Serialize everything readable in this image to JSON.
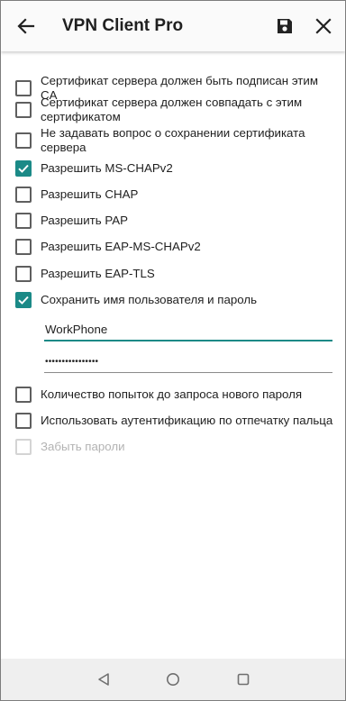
{
  "header": {
    "title": "VPN Client Pro"
  },
  "options": [
    {
      "label": "Сертификат сервера должен быть подписан этим CA",
      "checked": false,
      "disabled": false
    },
    {
      "label": "Сертификат сервера должен совпадать с этим сертификатом",
      "checked": false,
      "disabled": false
    },
    {
      "label": "Не задавать вопрос о сохранении сертификата сервера",
      "checked": false,
      "disabled": false
    },
    {
      "label": "Разрешить MS-CHAPv2",
      "checked": true,
      "disabled": false
    },
    {
      "label": "Разрешить CHAP",
      "checked": false,
      "disabled": false
    },
    {
      "label": "Разрешить PAP",
      "checked": false,
      "disabled": false
    },
    {
      "label": "Разрешить EAP-MS-CHAPv2",
      "checked": false,
      "disabled": false
    },
    {
      "label": "Разрешить EAP-TLS",
      "checked": false,
      "disabled": false
    },
    {
      "label": "Сохранить имя пользователя и пароль",
      "checked": true,
      "disabled": false
    }
  ],
  "credentials": {
    "username": "WorkPhone",
    "password": "••••••••••••••••"
  },
  "options_after": [
    {
      "label": "Количество попыток до запроса нового пароля",
      "checked": false,
      "disabled": false
    },
    {
      "label": "Использовать аутентификацию по отпечатку пальца",
      "checked": false,
      "disabled": false
    },
    {
      "label": "Забыть пароли",
      "checked": false,
      "disabled": true
    }
  ],
  "colors": {
    "accent": "#1b8a87",
    "navbar": "#efefef"
  },
  "icons": {
    "back": "arrow-left-icon",
    "save": "floppy-disk-icon",
    "close": "close-icon",
    "nav_back": "triangle-back-icon",
    "nav_home": "circle-home-icon",
    "nav_recents": "square-recents-icon"
  }
}
